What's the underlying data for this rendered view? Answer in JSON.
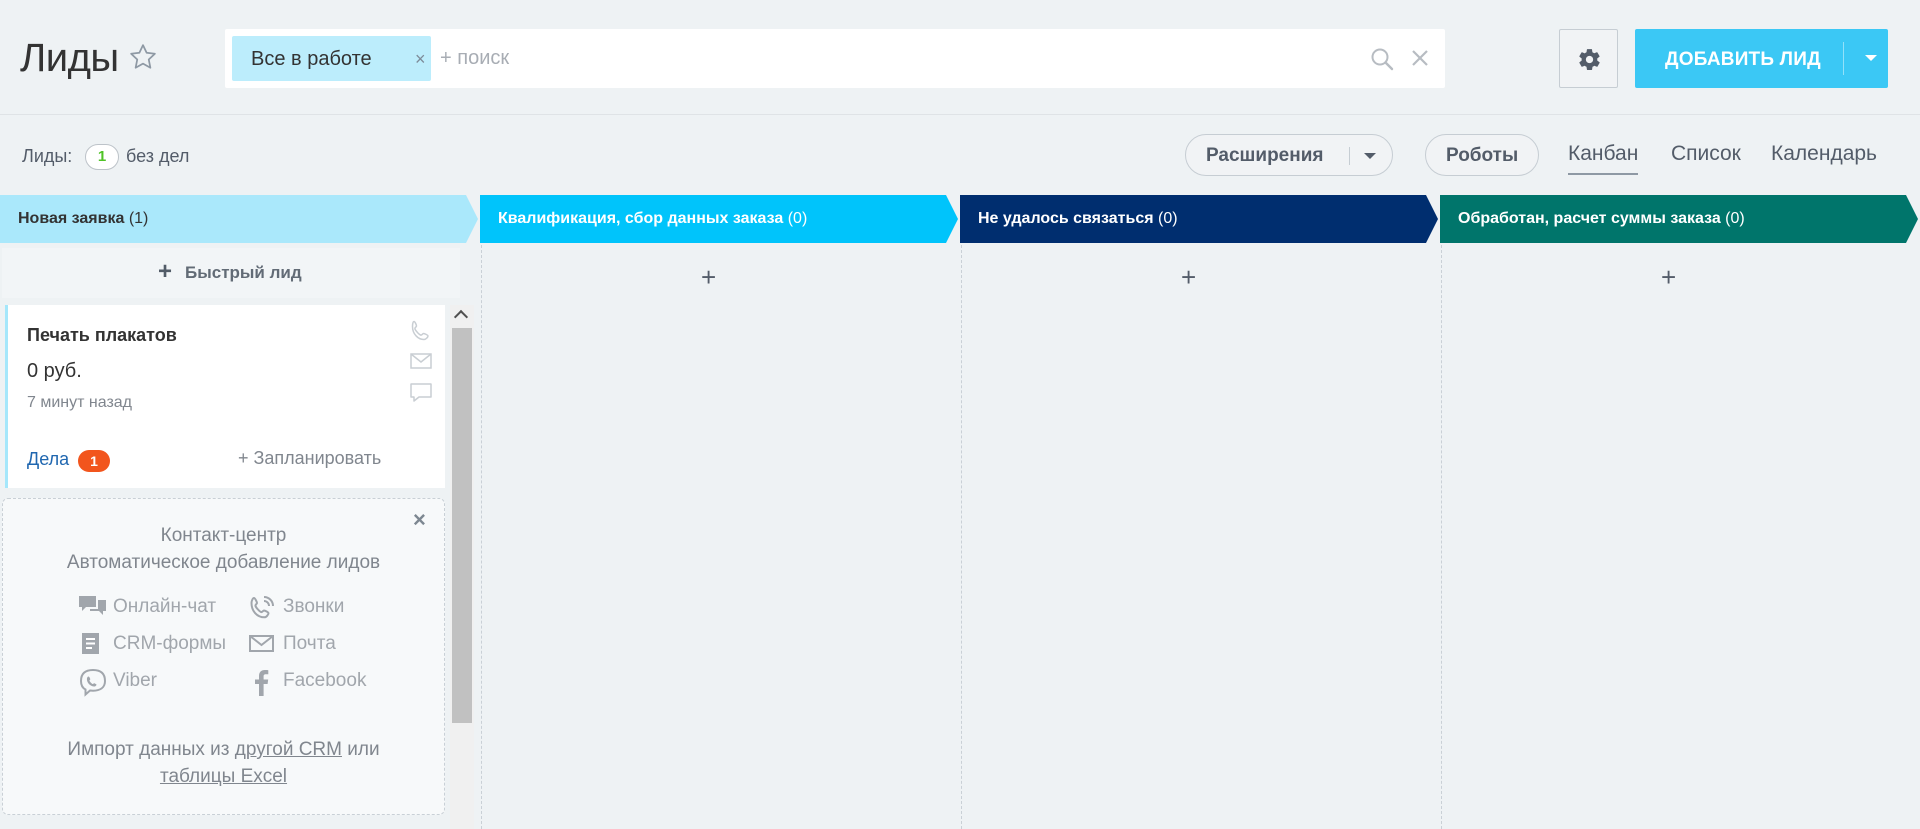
{
  "header": {
    "title": "Лиды",
    "filter_tag": "Все в работе",
    "filter_tag_close": "×",
    "search_placeholder": "+ поиск",
    "add_lead_label": "ДОБАВИТЬ ЛИД"
  },
  "toolbar": {
    "counter_label": "Лиды:",
    "counter_value": "1",
    "counter_suffix": "без дел",
    "extensions_label": "Расширения",
    "robots_label": "Роботы",
    "views": [
      "Канбан",
      "Список",
      "Календарь"
    ],
    "active_view": "Канбан"
  },
  "columns": [
    {
      "title": "Новая заявка",
      "count": "(1)",
      "color": "#aae8fb",
      "text_color": "#333333"
    },
    {
      "title": "Квалификация, сбор данных заказа",
      "count": "(0)",
      "color": "#00c4fb",
      "text_color": "#ffffff"
    },
    {
      "title": "Не удалось связаться",
      "count": "(0)",
      "color": "#002e6f",
      "text_color": "#ffffff"
    },
    {
      "title": "Обработан, расчет суммы заказа",
      "count": "(0)",
      "color": "#00756b",
      "text_color": "#ffffff"
    }
  ],
  "column_add": "+",
  "quick_lead": {
    "plus": "+",
    "label": "Быстрый лид"
  },
  "card": {
    "title": "Печать плакатов",
    "price": "0 руб.",
    "time": "7 минут назад",
    "deals_label": "Дела",
    "deals_count": "1",
    "plan_label": "+ Запланировать"
  },
  "contact_center": {
    "close": "×",
    "title_line1": "Контакт-центр",
    "title_line2": "Автоматическое добавление лидов",
    "items": [
      "Онлайн-чат",
      "Звонки",
      "CRM-формы",
      "Почта",
      "Viber",
      "Facebook"
    ],
    "import_prefix": "Импорт данных из",
    "import_link1": "другой CRM",
    "import_or": "или",
    "import_link2": "таблицы Excel"
  },
  "colors": {
    "accent": "#3bc8f5",
    "badge_orange": "#f2551d",
    "counter_green": "#4fc326",
    "link_blue": "#2067b0"
  }
}
